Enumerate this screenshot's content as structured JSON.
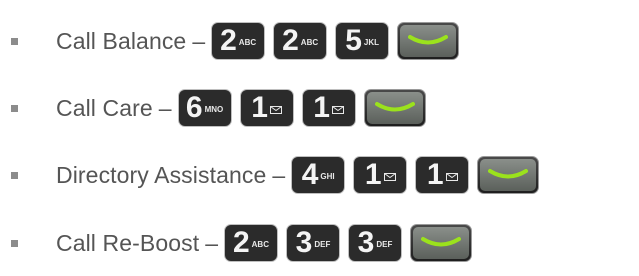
{
  "items": [
    {
      "label": "Call Balance",
      "separator": "–",
      "keys": [
        {
          "digit": "2",
          "letters": "ABC"
        },
        {
          "digit": "2",
          "letters": "ABC"
        },
        {
          "digit": "5",
          "letters": "JKL"
        }
      ]
    },
    {
      "label": "Call Care",
      "separator": "–",
      "keys": [
        {
          "digit": "6",
          "letters": "MNO"
        },
        {
          "digit": "1",
          "icon": "envelope-icon"
        },
        {
          "digit": "1",
          "icon": "envelope-icon"
        }
      ]
    },
    {
      "label": "Directory Assistance",
      "separator": "–",
      "keys": [
        {
          "digit": "4",
          "letters": "GHI"
        },
        {
          "digit": "1",
          "icon": "envelope-icon"
        },
        {
          "digit": "1",
          "icon": "envelope-icon"
        }
      ]
    },
    {
      "label": "Call Re-Boost",
      "separator": "–",
      "keys": [
        {
          "digit": "2",
          "letters": "ABC"
        },
        {
          "digit": "3",
          "letters": "DEF"
        },
        {
          "digit": "3",
          "letters": "DEF"
        }
      ]
    }
  ],
  "send_key": {
    "icon": "send-key-icon",
    "accent": "#9be21c"
  },
  "colors": {
    "text": "#555555",
    "bullet": "#8c8c8c",
    "key_bg": "#2b2b2b"
  }
}
